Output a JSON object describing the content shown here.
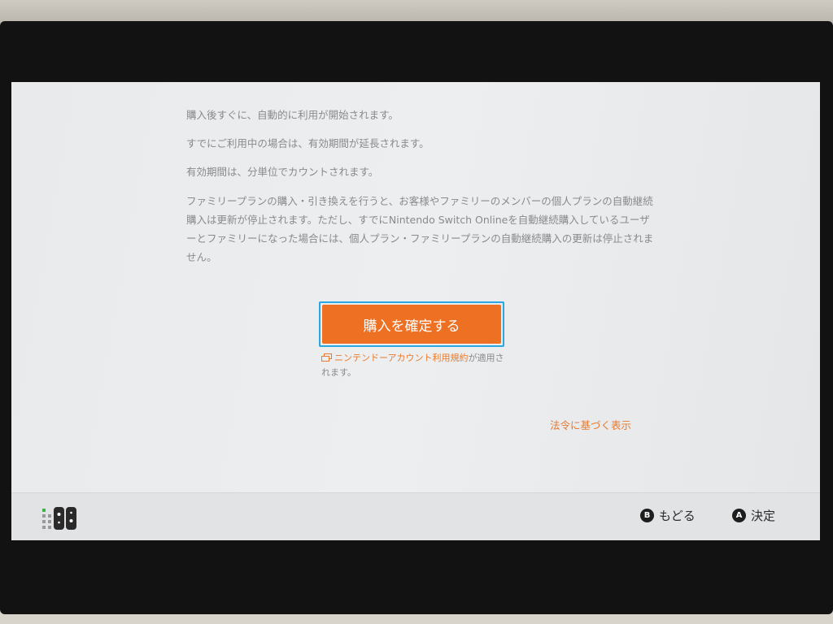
{
  "body": {
    "paragraphs": [
      "購入後すぐに、自動的に利用が開始されます。",
      "すでにご利用中の場合は、有効期間が延長されます。",
      "有効期間は、分単位でカウントされます。",
      "ファミリープランの購入・引き換えを行うと、お客様やファミリーのメンバーの個人プランの自動継続購入は更新が停止されます。ただし、すでにNintendo Switch Onlineを自動継続購入しているユーザーとファミリーになった場合には、個人プラン・ファミリープランの自動継続購入の更新は停止されません。"
    ]
  },
  "confirm_button": {
    "label": "購入を確定する"
  },
  "terms": {
    "link_label": "ニンテンドーアカウント利用規約",
    "suffix": "が適用されます。"
  },
  "legal_link": {
    "label": "法令に基づく表示"
  },
  "footer": {
    "back": {
      "glyph": "B",
      "label": "もどる"
    },
    "ok": {
      "glyph": "A",
      "label": "決定"
    }
  },
  "colors": {
    "accent": "#ee7022",
    "focus": "#2aa6e0",
    "link": "#e87a2e"
  },
  "icons": {
    "terms": "external-window-icon",
    "controller": "joycon-controller-icon"
  }
}
